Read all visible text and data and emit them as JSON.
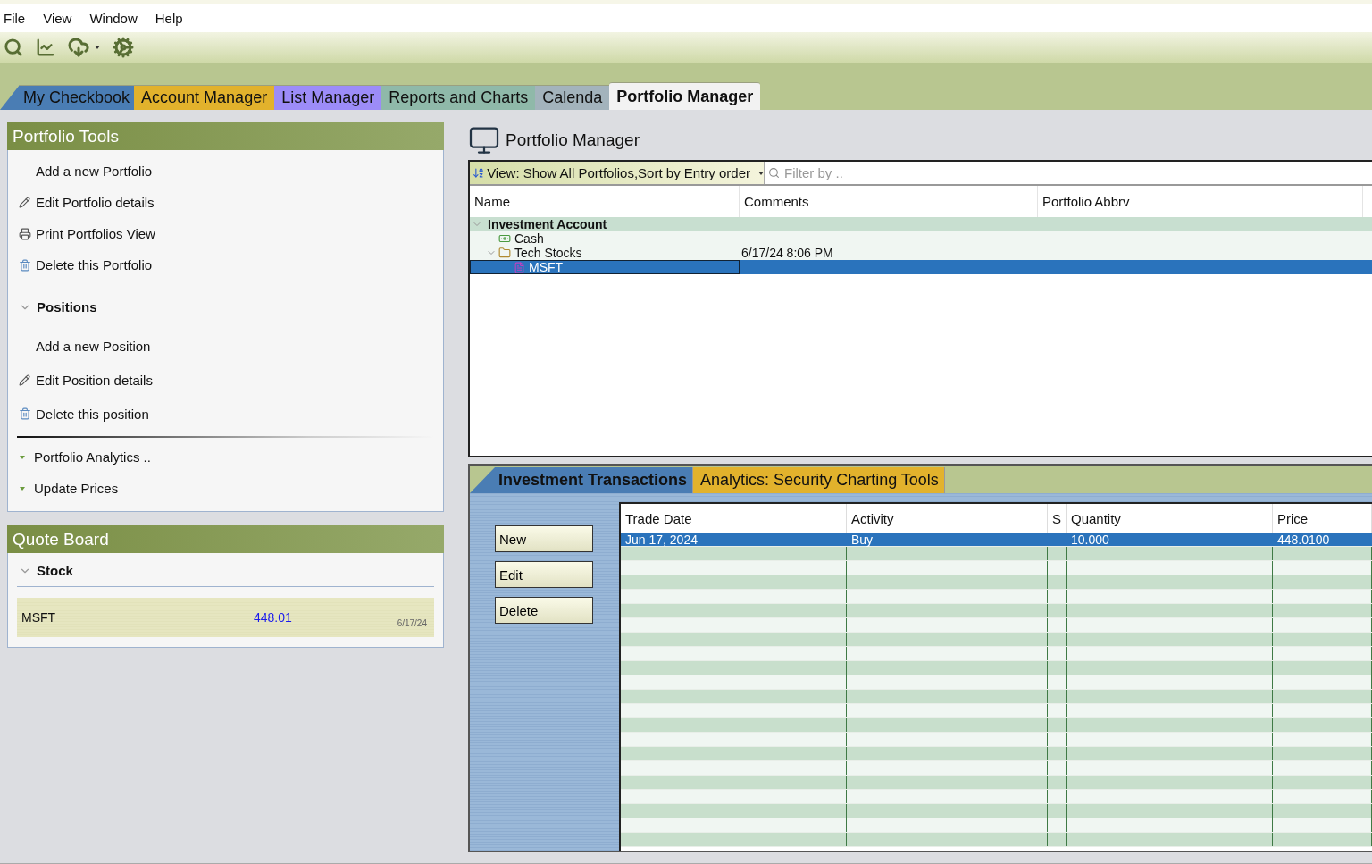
{
  "menu": [
    "File",
    "View",
    "Window",
    "Help"
  ],
  "toolbar": [
    {
      "kind": "search"
    },
    {
      "kind": "chart"
    },
    {
      "kind": "download",
      "dropdown": true
    },
    {
      "kind": "settings"
    }
  ],
  "tabs": [
    {
      "label": "My Checkbook",
      "selected": false,
      "color": "#4a7db4"
    },
    {
      "label": "Account Manager",
      "selected": false,
      "color": "#e2b22c"
    },
    {
      "label": "List Manager",
      "selected": false,
      "color": "#9c8cf8"
    },
    {
      "label": "Reports and Charts",
      "selected": false,
      "color": "#8fb9a9"
    },
    {
      "label": "Calenda",
      "selected": false,
      "color": "#a3b3bc"
    },
    {
      "label": "Portfolio Manager",
      "selected": true,
      "color": "#f2f2f2"
    }
  ],
  "portfolio_tools": {
    "title": "Portfolio Tools",
    "items": [
      {
        "label": "Add a new Portfolio",
        "kind": "plain"
      },
      {
        "label": "Edit Portfolio details",
        "kind": "edit"
      },
      {
        "label": "Print Portfolios View",
        "kind": "print"
      },
      {
        "label": "Delete this Portfolio",
        "kind": "delete"
      }
    ],
    "positions": {
      "title": "Positions",
      "expanded": true,
      "items": [
        {
          "label": "Add a new Position",
          "kind": "plain"
        },
        {
          "label": "Edit Position details",
          "kind": "edit"
        },
        {
          "label": "Delete this position",
          "kind": "delete"
        }
      ]
    },
    "links": [
      "Portfolio Analytics ..",
      "Update Prices"
    ]
  },
  "quote_board": {
    "title": "Quote Board",
    "section": {
      "title": "Stock",
      "expanded": true
    },
    "rows": [
      {
        "symbol": "MSFT",
        "price": "448.01",
        "date": "6/17/24"
      }
    ]
  },
  "portfolio_manager": {
    "title": "Portfolio Manager",
    "view": "View: Show All Portfolios,Sort by Entry order",
    "filter": {
      "placeholder": "Filter by .."
    },
    "columns": [
      "Name",
      "Comments",
      "Portfolio Abbrv"
    ],
    "tree": [
      {
        "name": "Investment Account",
        "kind": "account",
        "expanded": true,
        "selected": false,
        "children": [
          {
            "name": "Cash",
            "kind": "cash",
            "selected": false
          },
          {
            "name": "Tech Stocks",
            "kind": "portfolio",
            "comments": "6/17/24 8:06 PM",
            "expanded": true,
            "selected": false,
            "children": [
              {
                "name": "MSFT",
                "kind": "security",
                "selected": true
              }
            ]
          }
        ]
      }
    ]
  },
  "transactions": {
    "tabs": [
      {
        "label": "Investment Transactions",
        "selected": true,
        "color": "#4a7db4"
      },
      {
        "label": "Analytics: Security Charting Tools",
        "selected": false,
        "color": "#e2b22c"
      }
    ],
    "buttons": [
      "New",
      "Edit",
      "Delete"
    ],
    "columns": [
      "Trade Date",
      "Activity",
      "S",
      "Quantity",
      "Price"
    ],
    "rows": [
      {
        "cells": [
          "Jun 17, 2024",
          "Buy",
          "",
          "10.000",
          "448.0100"
        ],
        "selected": true
      }
    ]
  }
}
